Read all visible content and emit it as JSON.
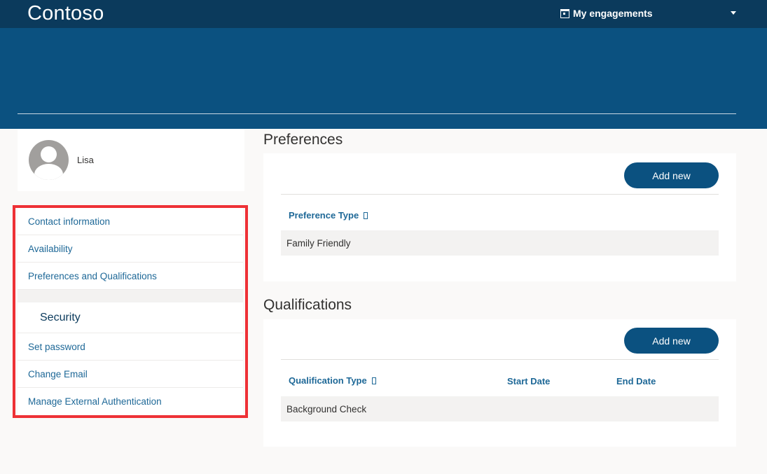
{
  "header": {
    "brand": "Contoso",
    "engagements_label": "My engagements"
  },
  "profile": {
    "name": "Lisa"
  },
  "nav": {
    "items": [
      {
        "label": "Contact information"
      },
      {
        "label": "Availability"
      },
      {
        "label": "Preferences and Qualifications"
      }
    ],
    "security_header": "Security",
    "security_items": [
      {
        "label": "Set password"
      },
      {
        "label": "Change Email"
      },
      {
        "label": "Manage External Authentication"
      }
    ]
  },
  "preferences": {
    "title": "Preferences",
    "add_label": "Add new",
    "columns": [
      "Preference Type"
    ],
    "rows": [
      [
        "Family Friendly"
      ]
    ]
  },
  "qualifications": {
    "title": "Qualifications",
    "add_label": "Add new",
    "columns": [
      "Qualification Type",
      "Start Date",
      "End Date"
    ],
    "rows": [
      [
        "Background Check",
        "",
        ""
      ]
    ]
  },
  "colors": {
    "topbar": "#0b3a5c",
    "hero": "#0b5180",
    "link": "#1e6897",
    "highlight_border": "#ee3136"
  }
}
